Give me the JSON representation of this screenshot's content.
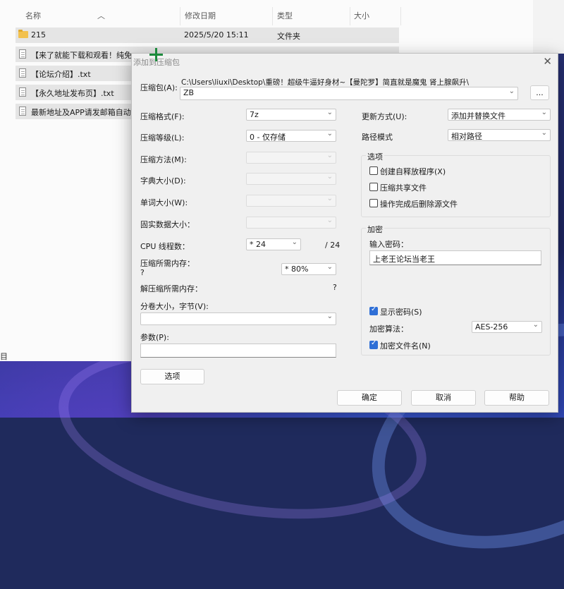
{
  "explorer": {
    "columns": {
      "name": "名称",
      "date": "修改日期",
      "type": "类型",
      "size": "大小"
    },
    "rows": [
      {
        "name": "215",
        "date": "2025/5/20 15:11",
        "type": "文件夹",
        "kind": "folder"
      },
      {
        "name": "【来了就能下载和观看！纯免",
        "date": "",
        "type": "",
        "kind": "file"
      },
      {
        "name": "【论坛介绍】.txt",
        "date": "",
        "type": "",
        "kind": "file"
      },
      {
        "name": "【永久地址发布页】.txt",
        "date": "",
        "type": "",
        "kind": "file"
      },
      {
        "name": "最新地址及APP请发邮箱自动",
        "date": "",
        "type": "",
        "kind": "file"
      }
    ],
    "status_fragment": "目"
  },
  "dialog": {
    "title": "添加到压缩包",
    "close_icon": "close-icon",
    "archive_label": "压缩包(A):",
    "archive_path": "C:\\Users\\liuxi\\Desktop\\重磅！超级牛逼好身材~【曼陀罗】简直就是魔鬼 肾上腺飙升\\",
    "archive_name": "ZB",
    "browse_label": "...",
    "left": {
      "format": {
        "label": "压缩格式(F):",
        "value": "7z"
      },
      "level": {
        "label": "压缩等级(L):",
        "value": "0 - 仅存储"
      },
      "method": {
        "label": "压缩方法(M):",
        "value": ""
      },
      "dict": {
        "label": "字典大小(D):",
        "value": ""
      },
      "word": {
        "label": "单词大小(W):",
        "value": ""
      },
      "solid": {
        "label": "固实数据大小：",
        "value": ""
      },
      "threads": {
        "label": "CPU 线程数：",
        "value": "* 24",
        "max": "/ 24"
      },
      "mem_compress": {
        "label": "压缩所需内存：",
        "sub": "?",
        "value": "* 80%"
      },
      "mem_decomp": {
        "label": "解压缩所需内存：",
        "value": "?"
      },
      "volume": {
        "label": "分卷大小，字节(V):",
        "value": ""
      },
      "params": {
        "label": "参数(P):",
        "value": ""
      },
      "options_button": "选项"
    },
    "right": {
      "update": {
        "label": "更新方式(U):",
        "value": "添加并替换文件"
      },
      "pathmode": {
        "label": "路径模式",
        "value": "相对路径"
      },
      "options_group": "选项",
      "opt_sfx": {
        "label": "创建自释放程序(X)",
        "checked": false
      },
      "opt_shared": {
        "label": "压缩共享文件",
        "checked": false
      },
      "opt_delete": {
        "label": "操作完成后删除源文件",
        "checked": false
      },
      "encrypt_group": "加密",
      "password_label": "输入密码：",
      "password_value": "上老王论坛当老王",
      "show_password": {
        "label": "显示密码(S)",
        "checked": true
      },
      "enc_method": {
        "label": "加密算法：",
        "value": "AES-256"
      },
      "enc_names": {
        "label": "加密文件名(N)",
        "checked": true
      }
    },
    "buttons": {
      "ok": "确定",
      "cancel": "取消",
      "help": "帮助"
    }
  }
}
